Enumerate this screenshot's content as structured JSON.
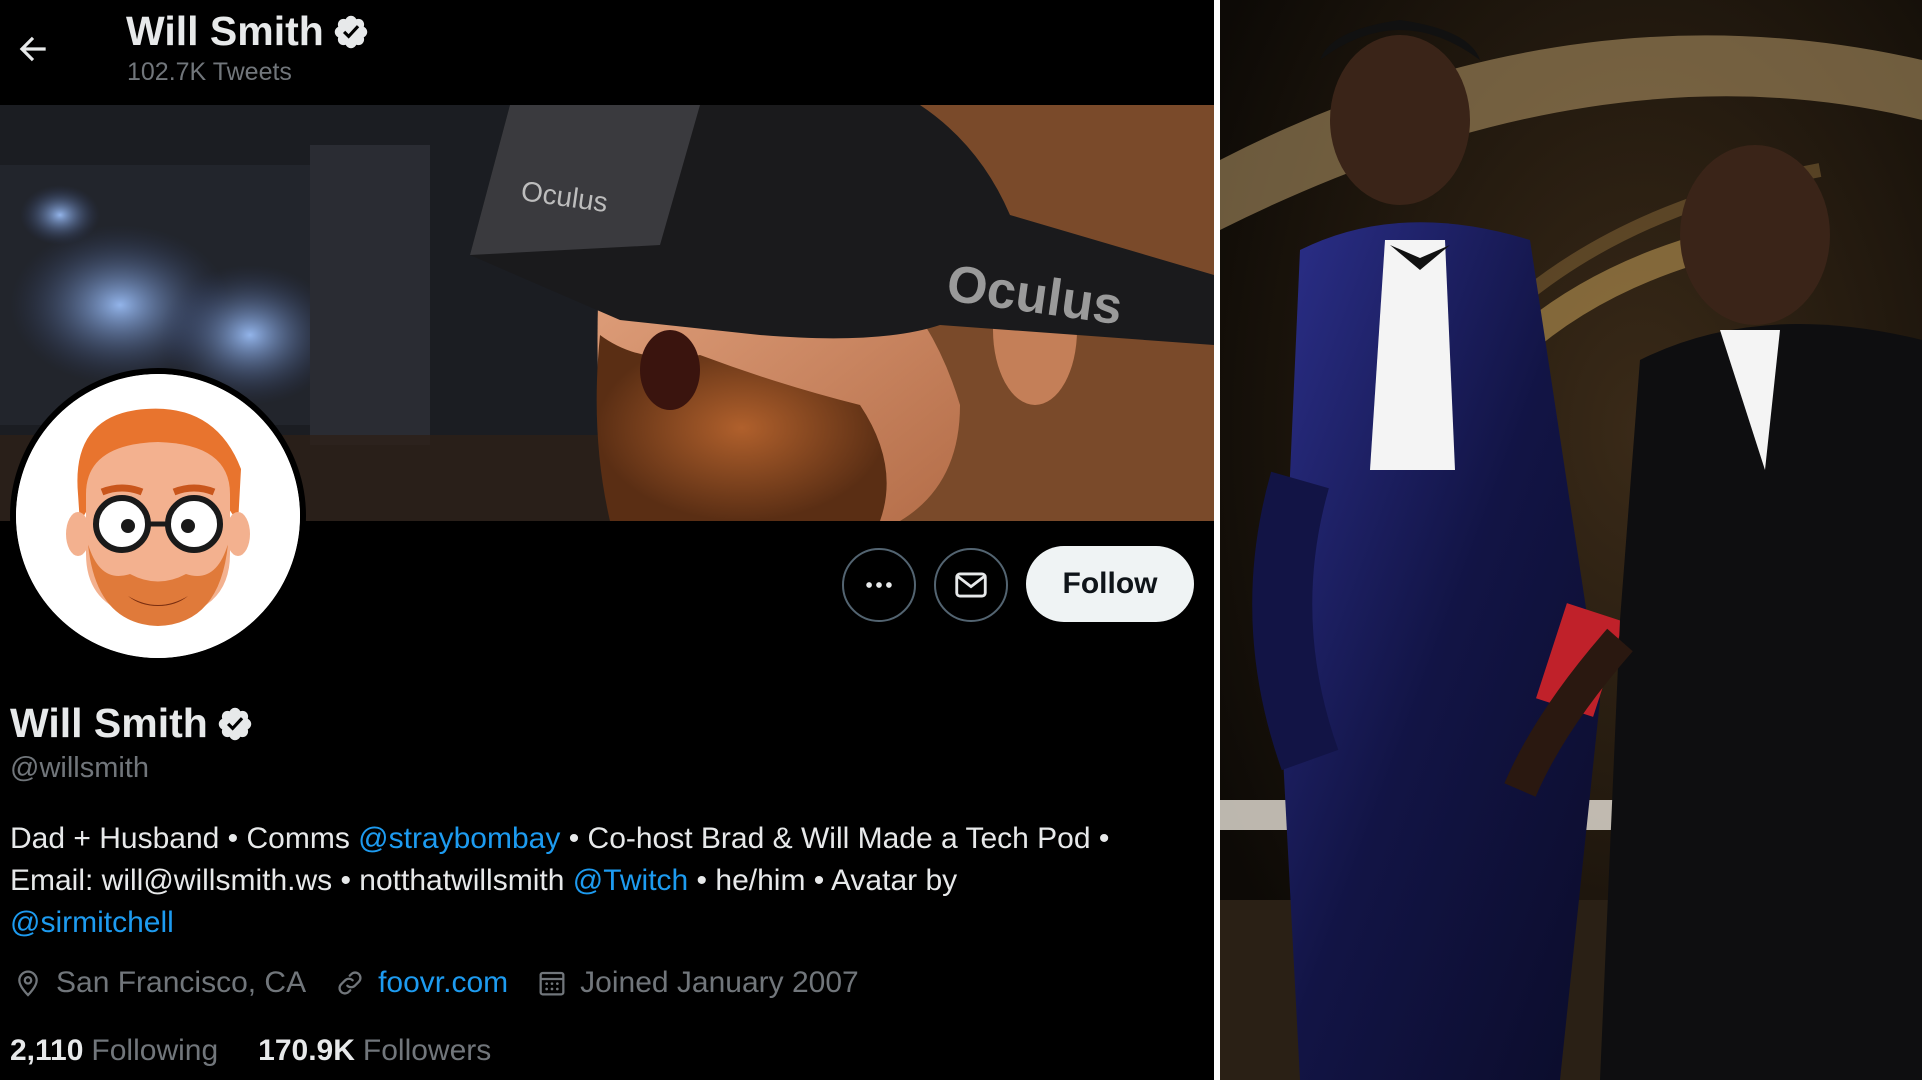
{
  "header": {
    "name": "Will Smith",
    "tweet_count": "102.7K Tweets"
  },
  "icons": {
    "back": "arrow-left-icon",
    "verified": "verified-badge-icon",
    "more": "more-horizontal-icon",
    "message": "envelope-icon",
    "location": "location-pin-icon",
    "link": "link-icon",
    "calendar": "calendar-icon"
  },
  "banner": {
    "brand_text": "Oculus"
  },
  "actions": {
    "follow_label": "Follow"
  },
  "profile": {
    "name": "Will Smith",
    "handle": "@willsmith",
    "bio": {
      "t1": "Dad + Husband • Comms ",
      "m1": "@straybombay",
      "t2": " • Co-host Brad & Will Made a Tech Pod •",
      "t3": "Email: will@willsmith.ws • notthatwillsmith ",
      "m2": "@Twitch",
      "t4": " • he/him • Avatar by",
      "m3": "@sirmitchell"
    },
    "location": "San Francisco, CA",
    "website": "foovr.com",
    "joined": "Joined January 2007",
    "following_count": "2,110",
    "following_label": "Following",
    "followers_count": "170.9K",
    "followers_label": "Followers"
  },
  "colors": {
    "background": "#000000",
    "text": "#e7e9ea",
    "muted": "#71767b",
    "accent": "#1d9bf0",
    "follow_bg": "#eff3f4",
    "verified": "#e7e9ea"
  }
}
